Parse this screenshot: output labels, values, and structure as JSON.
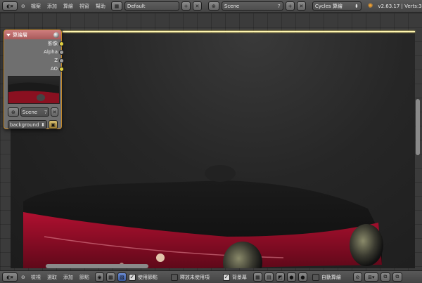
{
  "topbar": {
    "menus": [
      "檔案",
      "添加",
      "算繪",
      "視窗",
      "幫助"
    ],
    "layout_value": "Default",
    "scene_value": "Scene",
    "scene_users": "7",
    "engine_value": "Cycles 算繪",
    "version_text": "v2.63.17 | Verts:3"
  },
  "node": {
    "title": "算繪層",
    "outputs": [
      {
        "label": "影像",
        "color": "#e0d040"
      },
      {
        "label": "Alpha",
        "color": "#a0a0a0"
      },
      {
        "label": "Z",
        "color": "#a0a0a0"
      },
      {
        "label": "AO",
        "color": "#e0d040"
      }
    ],
    "scene_value": "Scene",
    "scene_users": "7",
    "layer_value": "background"
  },
  "bottombar": {
    "menus": [
      "檢視",
      "選取",
      "添加",
      "節點"
    ],
    "use_nodes_label": "使用節點",
    "free_unused_label": "釋放未使用項",
    "backdrop_label": "背景幕",
    "auto_render_label": "自動算繪"
  },
  "colors": {
    "node_border": "#c58a2a",
    "node_header": "#b86a6a",
    "link": "#fff6b0"
  }
}
